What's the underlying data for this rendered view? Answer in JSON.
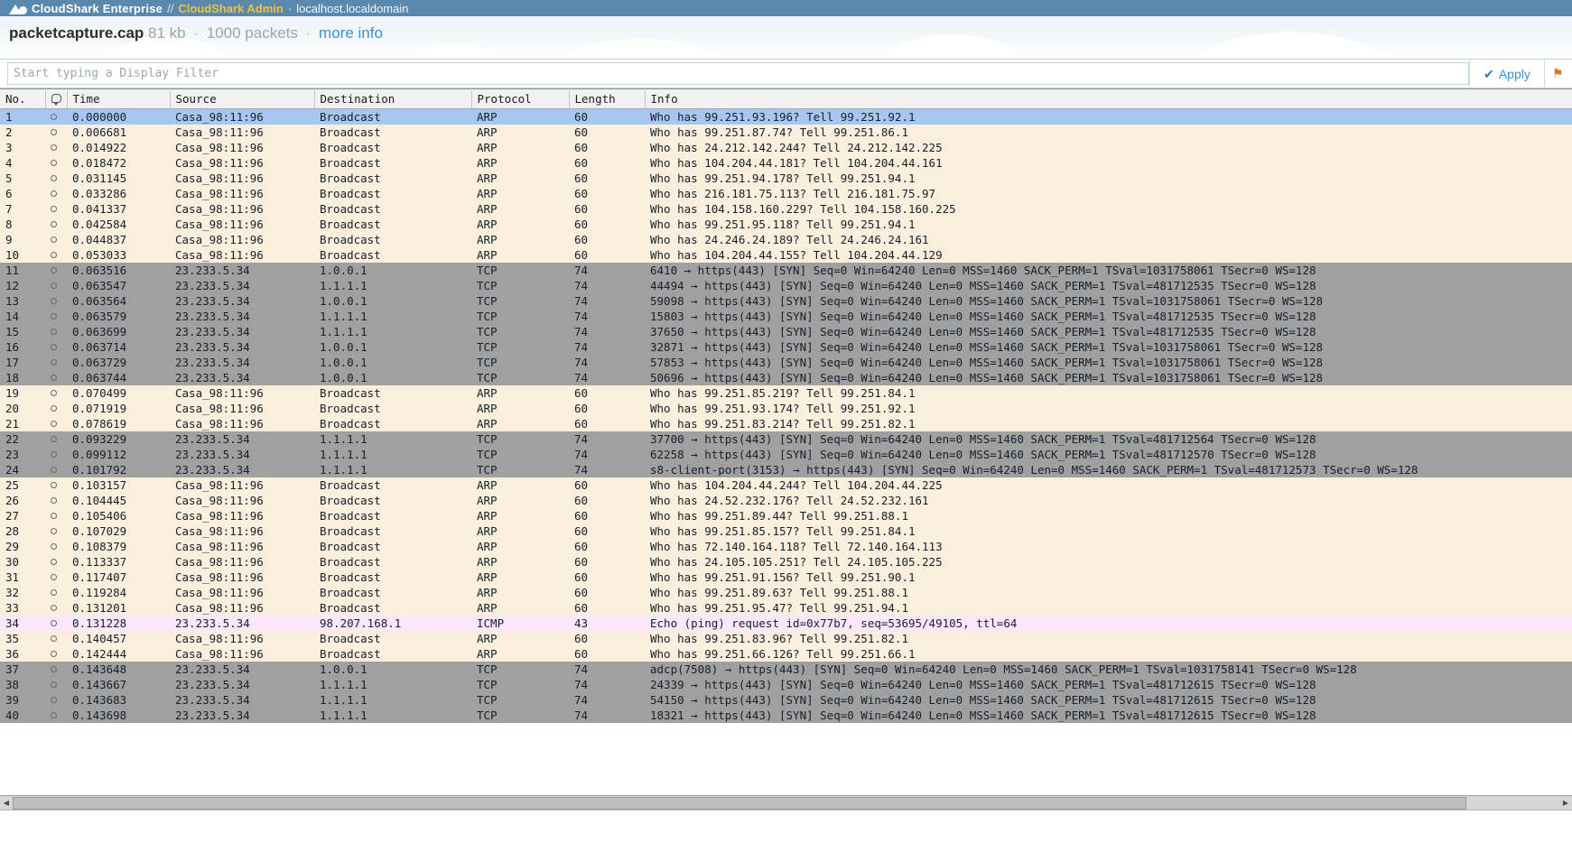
{
  "topbar": {
    "logo_icon": "shark-fin-logo",
    "brand": "CloudShark Enterprise",
    "separator": "//",
    "admin_link": "CloudShark Admin",
    "host_separator": "·",
    "host": "localhost.localdomain"
  },
  "caption": {
    "filename": "packetcapture.cap",
    "size": "81 kb",
    "sep1": "·",
    "packets": "1000 packets",
    "sep2": "·",
    "more_info": "more info"
  },
  "filter": {
    "placeholder": "Start typing a Display Filter",
    "value": "",
    "apply_label": "Apply",
    "apply_icon": "check-icon",
    "extra_icon": "bookmark-icon"
  },
  "colors": {
    "topbar_bg": "#5b89ad",
    "admin_link": "#f0c040",
    "link_blue": "#3b8fd0",
    "arp_row": "#faeedc",
    "tcp_row": "#a0a0a0",
    "icmp_row": "#fbe6fb",
    "selected_row": "#a6c8f0",
    "selected_border": "#2f6fb5",
    "header_bg": "#f1f1f1"
  },
  "table": {
    "columns": [
      "No.",
      "",
      "Time",
      "Source",
      "Destination",
      "Protocol",
      "Length",
      "Info"
    ],
    "comment_column_icon": "comment-icon",
    "rows": [
      {
        "no": "1",
        "time": "0.000000",
        "src": "Casa_98:11:96",
        "dst": "Broadcast",
        "proto": "ARP",
        "len": "60",
        "info": "Who has 99.251.93.196? Tell 99.251.92.1",
        "kind": "sel"
      },
      {
        "no": "2",
        "time": "0.006681",
        "src": "Casa_98:11:96",
        "dst": "Broadcast",
        "proto": "ARP",
        "len": "60",
        "info": "Who has 99.251.87.74? Tell 99.251.86.1",
        "kind": "arp"
      },
      {
        "no": "3",
        "time": "0.014922",
        "src": "Casa_98:11:96",
        "dst": "Broadcast",
        "proto": "ARP",
        "len": "60",
        "info": "Who has 24.212.142.244? Tell 24.212.142.225",
        "kind": "arp"
      },
      {
        "no": "4",
        "time": "0.018472",
        "src": "Casa_98:11:96",
        "dst": "Broadcast",
        "proto": "ARP",
        "len": "60",
        "info": "Who has 104.204.44.181? Tell 104.204.44.161",
        "kind": "arp"
      },
      {
        "no": "5",
        "time": "0.031145",
        "src": "Casa_98:11:96",
        "dst": "Broadcast",
        "proto": "ARP",
        "len": "60",
        "info": "Who has 99.251.94.178? Tell 99.251.94.1",
        "kind": "arp"
      },
      {
        "no": "6",
        "time": "0.033286",
        "src": "Casa_98:11:96",
        "dst": "Broadcast",
        "proto": "ARP",
        "len": "60",
        "info": "Who has 216.181.75.113? Tell 216.181.75.97",
        "kind": "arp"
      },
      {
        "no": "7",
        "time": "0.041337",
        "src": "Casa_98:11:96",
        "dst": "Broadcast",
        "proto": "ARP",
        "len": "60",
        "info": "Who has 104.158.160.229? Tell 104.158.160.225",
        "kind": "arp"
      },
      {
        "no": "8",
        "time": "0.042584",
        "src": "Casa_98:11:96",
        "dst": "Broadcast",
        "proto": "ARP",
        "len": "60",
        "info": "Who has 99.251.95.118? Tell 99.251.94.1",
        "kind": "arp"
      },
      {
        "no": "9",
        "time": "0.044837",
        "src": "Casa_98:11:96",
        "dst": "Broadcast",
        "proto": "ARP",
        "len": "60",
        "info": "Who has 24.246.24.189? Tell 24.246.24.161",
        "kind": "arp"
      },
      {
        "no": "10",
        "time": "0.053033",
        "src": "Casa_98:11:96",
        "dst": "Broadcast",
        "proto": "ARP",
        "len": "60",
        "info": "Who has 104.204.44.155? Tell 104.204.44.129",
        "kind": "arp"
      },
      {
        "no": "11",
        "time": "0.063516",
        "src": "23.233.5.34",
        "dst": "1.0.0.1",
        "proto": "TCP",
        "len": "74",
        "info": "6410 → https(443) [SYN] Seq=0 Win=64240 Len=0 MSS=1460 SACK_PERM=1 TSval=1031758061 TSecr=0 WS=128",
        "kind": "tcp"
      },
      {
        "no": "12",
        "time": "0.063547",
        "src": "23.233.5.34",
        "dst": "1.1.1.1",
        "proto": "TCP",
        "len": "74",
        "info": "44494 → https(443) [SYN] Seq=0 Win=64240 Len=0 MSS=1460 SACK_PERM=1 TSval=481712535 TSecr=0 WS=128",
        "kind": "tcp"
      },
      {
        "no": "13",
        "time": "0.063564",
        "src": "23.233.5.34",
        "dst": "1.0.0.1",
        "proto": "TCP",
        "len": "74",
        "info": "59098 → https(443) [SYN] Seq=0 Win=64240 Len=0 MSS=1460 SACK_PERM=1 TSval=1031758061 TSecr=0 WS=128",
        "kind": "tcp"
      },
      {
        "no": "14",
        "time": "0.063579",
        "src": "23.233.5.34",
        "dst": "1.1.1.1",
        "proto": "TCP",
        "len": "74",
        "info": "15803 → https(443) [SYN] Seq=0 Win=64240 Len=0 MSS=1460 SACK_PERM=1 TSval=481712535 TSecr=0 WS=128",
        "kind": "tcp"
      },
      {
        "no": "15",
        "time": "0.063699",
        "src": "23.233.5.34",
        "dst": "1.1.1.1",
        "proto": "TCP",
        "len": "74",
        "info": "37650 → https(443) [SYN] Seq=0 Win=64240 Len=0 MSS=1460 SACK_PERM=1 TSval=481712535 TSecr=0 WS=128",
        "kind": "tcp"
      },
      {
        "no": "16",
        "time": "0.063714",
        "src": "23.233.5.34",
        "dst": "1.0.0.1",
        "proto": "TCP",
        "len": "74",
        "info": "32871 → https(443) [SYN] Seq=0 Win=64240 Len=0 MSS=1460 SACK_PERM=1 TSval=1031758061 TSecr=0 WS=128",
        "kind": "tcp"
      },
      {
        "no": "17",
        "time": "0.063729",
        "src": "23.233.5.34",
        "dst": "1.0.0.1",
        "proto": "TCP",
        "len": "74",
        "info": "57853 → https(443) [SYN] Seq=0 Win=64240 Len=0 MSS=1460 SACK_PERM=1 TSval=1031758061 TSecr=0 WS=128",
        "kind": "tcp"
      },
      {
        "no": "18",
        "time": "0.063744",
        "src": "23.233.5.34",
        "dst": "1.0.0.1",
        "proto": "TCP",
        "len": "74",
        "info": "50696 → https(443) [SYN] Seq=0 Win=64240 Len=0 MSS=1460 SACK_PERM=1 TSval=1031758061 TSecr=0 WS=128",
        "kind": "tcp"
      },
      {
        "no": "19",
        "time": "0.070499",
        "src": "Casa_98:11:96",
        "dst": "Broadcast",
        "proto": "ARP",
        "len": "60",
        "info": "Who has 99.251.85.219? Tell 99.251.84.1",
        "kind": "arp"
      },
      {
        "no": "20",
        "time": "0.071919",
        "src": "Casa_98:11:96",
        "dst": "Broadcast",
        "proto": "ARP",
        "len": "60",
        "info": "Who has 99.251.93.174? Tell 99.251.92.1",
        "kind": "arp"
      },
      {
        "no": "21",
        "time": "0.078619",
        "src": "Casa_98:11:96",
        "dst": "Broadcast",
        "proto": "ARP",
        "len": "60",
        "info": "Who has 99.251.83.214? Tell 99.251.82.1",
        "kind": "arp"
      },
      {
        "no": "22",
        "time": "0.093229",
        "src": "23.233.5.34",
        "dst": "1.1.1.1",
        "proto": "TCP",
        "len": "74",
        "info": "37700 → https(443) [SYN] Seq=0 Win=64240 Len=0 MSS=1460 SACK_PERM=1 TSval=481712564 TSecr=0 WS=128",
        "kind": "tcp"
      },
      {
        "no": "23",
        "time": "0.099112",
        "src": "23.233.5.34",
        "dst": "1.1.1.1",
        "proto": "TCP",
        "len": "74",
        "info": "62258 → https(443) [SYN] Seq=0 Win=64240 Len=0 MSS=1460 SACK_PERM=1 TSval=481712570 TSecr=0 WS=128",
        "kind": "tcp"
      },
      {
        "no": "24",
        "time": "0.101792",
        "src": "23.233.5.34",
        "dst": "1.1.1.1",
        "proto": "TCP",
        "len": "74",
        "info": "s8-client-port(3153) → https(443) [SYN] Seq=0 Win=64240 Len=0 MSS=1460 SACK_PERM=1 TSval=481712573 TSecr=0 WS=128",
        "kind": "tcp"
      },
      {
        "no": "25",
        "time": "0.103157",
        "src": "Casa_98:11:96",
        "dst": "Broadcast",
        "proto": "ARP",
        "len": "60",
        "info": "Who has 104.204.44.244? Tell 104.204.44.225",
        "kind": "arp"
      },
      {
        "no": "26",
        "time": "0.104445",
        "src": "Casa_98:11:96",
        "dst": "Broadcast",
        "proto": "ARP",
        "len": "60",
        "info": "Who has 24.52.232.176? Tell 24.52.232.161",
        "kind": "arp"
      },
      {
        "no": "27",
        "time": "0.105406",
        "src": "Casa_98:11:96",
        "dst": "Broadcast",
        "proto": "ARP",
        "len": "60",
        "info": "Who has 99.251.89.44? Tell 99.251.88.1",
        "kind": "arp"
      },
      {
        "no": "28",
        "time": "0.107029",
        "src": "Casa_98:11:96",
        "dst": "Broadcast",
        "proto": "ARP",
        "len": "60",
        "info": "Who has 99.251.85.157? Tell 99.251.84.1",
        "kind": "arp"
      },
      {
        "no": "29",
        "time": "0.108379",
        "src": "Casa_98:11:96",
        "dst": "Broadcast",
        "proto": "ARP",
        "len": "60",
        "info": "Who has 72.140.164.118? Tell 72.140.164.113",
        "kind": "arp"
      },
      {
        "no": "30",
        "time": "0.113337",
        "src": "Casa_98:11:96",
        "dst": "Broadcast",
        "proto": "ARP",
        "len": "60",
        "info": "Who has 24.105.105.251? Tell 24.105.105.225",
        "kind": "arp"
      },
      {
        "no": "31",
        "time": "0.117407",
        "src": "Casa_98:11:96",
        "dst": "Broadcast",
        "proto": "ARP",
        "len": "60",
        "info": "Who has 99.251.91.156? Tell 99.251.90.1",
        "kind": "arp"
      },
      {
        "no": "32",
        "time": "0.119284",
        "src": "Casa_98:11:96",
        "dst": "Broadcast",
        "proto": "ARP",
        "len": "60",
        "info": "Who has 99.251.89.63? Tell 99.251.88.1",
        "kind": "arp"
      },
      {
        "no": "33",
        "time": "0.131201",
        "src": "Casa_98:11:96",
        "dst": "Broadcast",
        "proto": "ARP",
        "len": "60",
        "info": "Who has 99.251.95.47? Tell 99.251.94.1",
        "kind": "arp"
      },
      {
        "no": "34",
        "time": "0.131228",
        "src": "23.233.5.34",
        "dst": "98.207.168.1",
        "proto": "ICMP",
        "len": "43",
        "info": "Echo (ping) request id=0x77b7, seq=53695/49105, ttl=64",
        "kind": "icmp"
      },
      {
        "no": "35",
        "time": "0.140457",
        "src": "Casa_98:11:96",
        "dst": "Broadcast",
        "proto": "ARP",
        "len": "60",
        "info": "Who has 99.251.83.96? Tell 99.251.82.1",
        "kind": "arp"
      },
      {
        "no": "36",
        "time": "0.142444",
        "src": "Casa_98:11:96",
        "dst": "Broadcast",
        "proto": "ARP",
        "len": "60",
        "info": "Who has 99.251.66.126? Tell 99.251.66.1",
        "kind": "arp"
      },
      {
        "no": "37",
        "time": "0.143648",
        "src": "23.233.5.34",
        "dst": "1.0.0.1",
        "proto": "TCP",
        "len": "74",
        "info": "adcp(7508) → https(443) [SYN] Seq=0 Win=64240 Len=0 MSS=1460 SACK_PERM=1 TSval=1031758141 TSecr=0 WS=128",
        "kind": "tcp"
      },
      {
        "no": "38",
        "time": "0.143667",
        "src": "23.233.5.34",
        "dst": "1.1.1.1",
        "proto": "TCP",
        "len": "74",
        "info": "24339 → https(443) [SYN] Seq=0 Win=64240 Len=0 MSS=1460 SACK_PERM=1 TSval=481712615 TSecr=0 WS=128",
        "kind": "tcp"
      },
      {
        "no": "39",
        "time": "0.143683",
        "src": "23.233.5.34",
        "dst": "1.1.1.1",
        "proto": "TCP",
        "len": "74",
        "info": "54150 → https(443) [SYN] Seq=0 Win=64240 Len=0 MSS=1460 SACK_PERM=1 TSval=481712615 TSecr=0 WS=128",
        "kind": "tcp"
      },
      {
        "no": "40",
        "time": "0.143698",
        "src": "23.233.5.34",
        "dst": "1.1.1.1",
        "proto": "TCP",
        "len": "74",
        "info": "18321 → https(443) [SYN] Seq=0 Win=64240 Len=0 MSS=1460 SACK_PERM=1 TSval=481712615 TSecr=0 WS=128",
        "kind": "tcp"
      }
    ]
  },
  "scrollbar": {
    "left_arrow": "◀",
    "right_arrow": "▶"
  }
}
